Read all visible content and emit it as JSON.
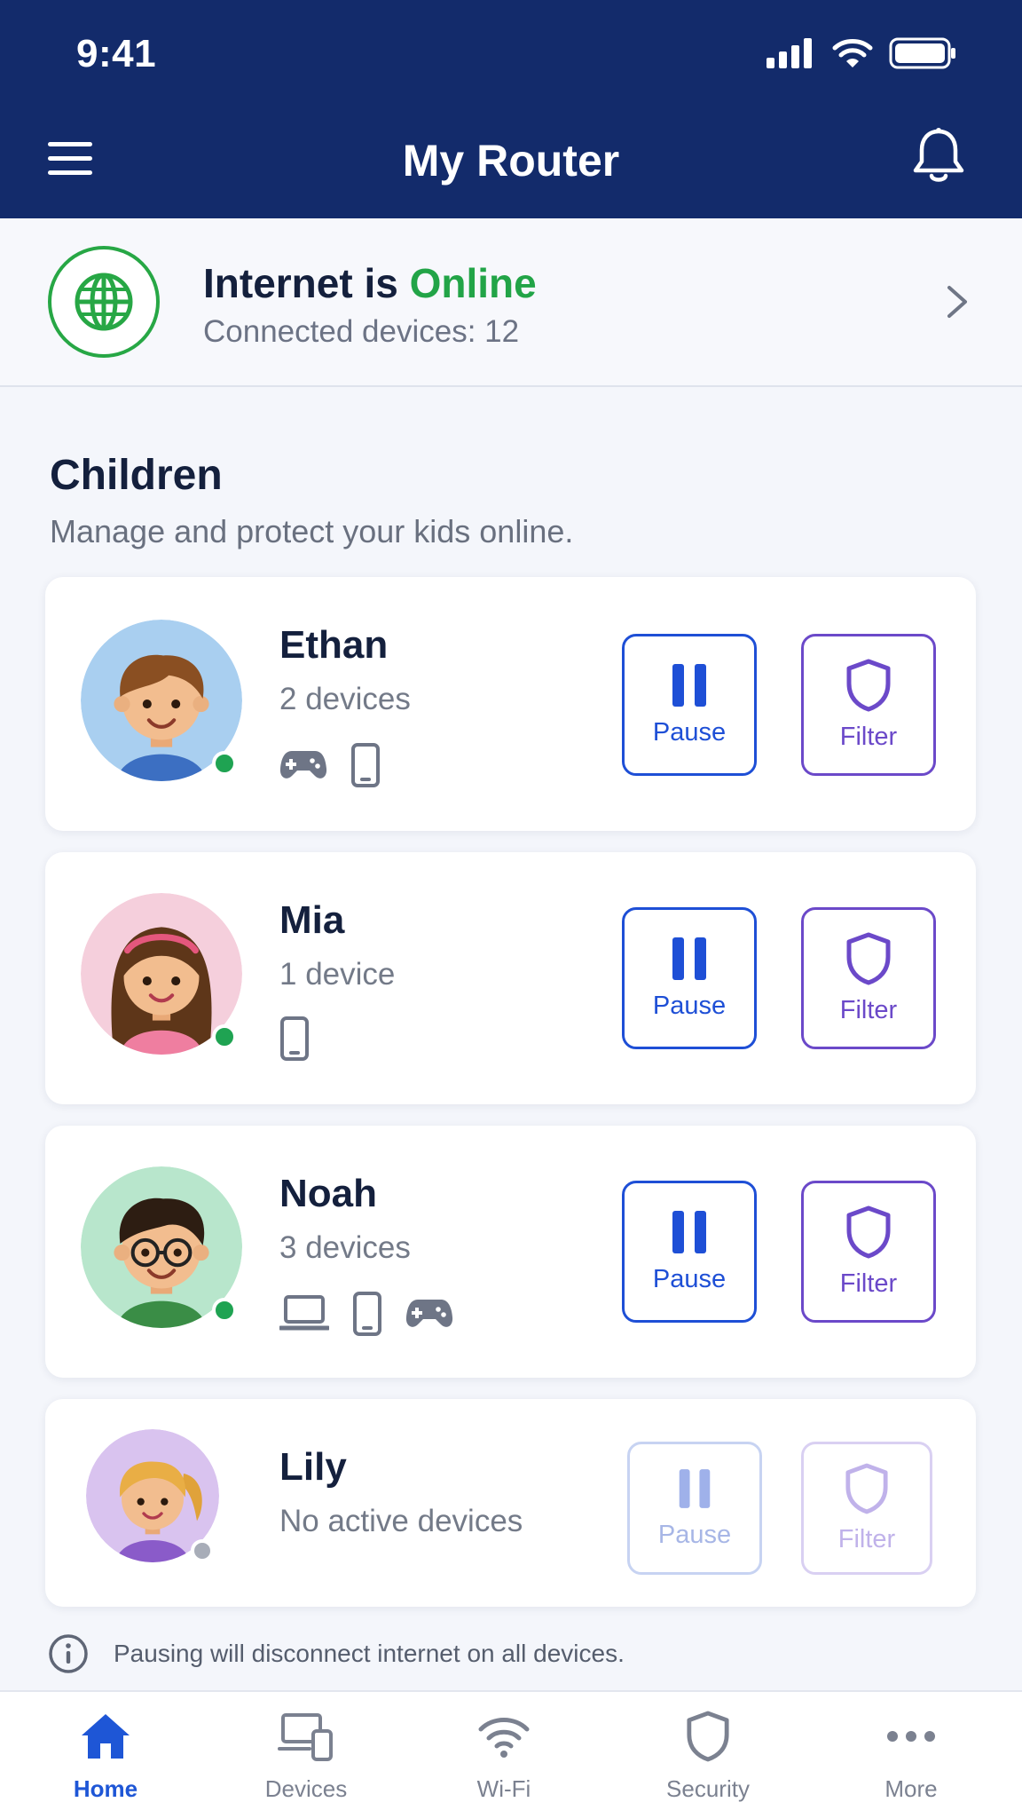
{
  "status_bar": {
    "time": "9:41"
  },
  "header": {
    "title": "My Router",
    "menu_icon": "hamburger-icon",
    "notification_icon": "bell-icon",
    "background_color": "#132b6b"
  },
  "internet": {
    "title_prefix": "Internet is ",
    "status": "Online",
    "subtitle": "Connected devices: 12",
    "status_color": "#22a447",
    "icon": "globe-icon"
  },
  "children_section": {
    "title": "Children",
    "subtitle": "Manage and protect your kids online."
  },
  "children": [
    {
      "name": "Ethan",
      "devices_text": "2 devices",
      "online": true,
      "device_icons": [
        "gamepad-icon",
        "phone-icon"
      ],
      "pause_label": "Pause",
      "filter_label": "Filter",
      "enabled": true
    },
    {
      "name": "Mia",
      "devices_text": "1 device",
      "online": true,
      "device_icons": [
        "phone-icon"
      ],
      "pause_label": "Pause",
      "filter_label": "Filter",
      "enabled": true
    },
    {
      "name": "Noah",
      "devices_text": "3 devices",
      "online": true,
      "device_icons": [
        "laptop-icon",
        "phone-icon",
        "gamepad-icon"
      ],
      "pause_label": "Pause",
      "filter_label": "Filter",
      "enabled": true
    },
    {
      "name": "Lily",
      "devices_text": "No active devices",
      "online": false,
      "device_icons": [],
      "pause_label": "Pause",
      "filter_label": "Filter",
      "enabled": false
    }
  ],
  "info_note": "Pausing will disconnect internet on all devices.",
  "bottom_nav": {
    "active": "Home",
    "items": [
      {
        "label": "Home",
        "icon": "home-icon"
      },
      {
        "label": "Devices",
        "icon": "devices-icon"
      },
      {
        "label": "Wi-Fi",
        "icon": "wifi-icon"
      },
      {
        "label": "Security",
        "icon": "shield-icon"
      },
      {
        "label": "More",
        "icon": "more-icon"
      }
    ]
  },
  "colors": {
    "pause_accent": "#1e4fd6",
    "filter_accent": "#6b49c9",
    "online_dot": "#1fa352",
    "offline_dot": "#a8adb8"
  }
}
